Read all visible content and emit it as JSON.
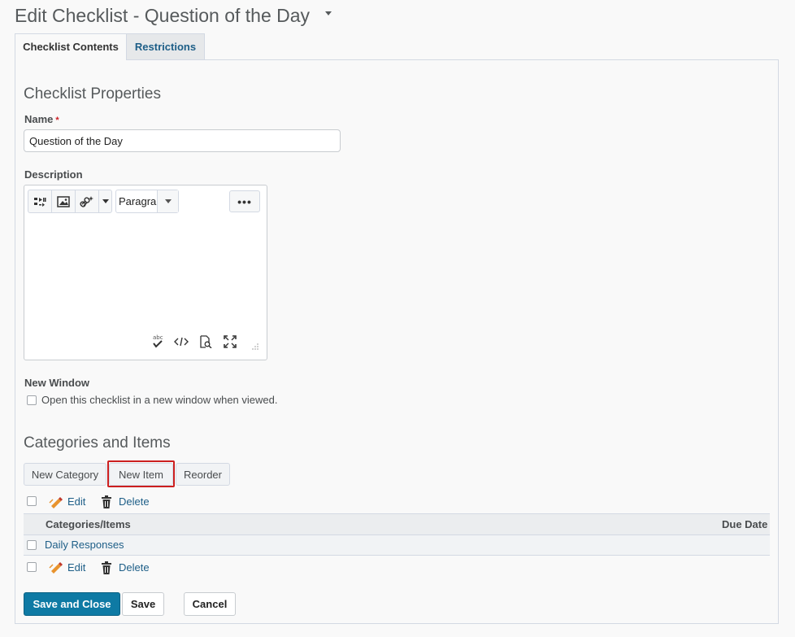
{
  "page": {
    "title": "Edit Checklist - Question of the Day"
  },
  "tabs": [
    {
      "label": "Checklist Contents"
    },
    {
      "label": "Restrictions"
    }
  ],
  "properties": {
    "heading": "Checklist Properties",
    "name_label": "Name",
    "required_marker": "*",
    "name_value": "Question of the Day",
    "description_label": "Description",
    "format_value": "Paragra",
    "more_label": "•••",
    "new_window_label": "New Window",
    "new_window_checkbox_label": "Open this checklist in a new window when viewed."
  },
  "categories": {
    "heading": "Categories and Items",
    "buttons": {
      "new_category": "New Category",
      "new_item": "New Item",
      "reorder": "Reorder"
    },
    "actions": {
      "edit": "Edit",
      "delete": "Delete"
    },
    "table": {
      "columns": [
        "Categories/Items",
        "Due Date"
      ],
      "rows": [
        {
          "name": "Daily Responses",
          "due_date": ""
        }
      ]
    }
  },
  "footer": {
    "save_and_close": "Save and Close",
    "save": "Save",
    "cancel": "Cancel"
  },
  "colors": {
    "primary": "#0e7aa4",
    "link": "#1d5e87",
    "highlight": "#cc1f1f",
    "icon_orange": "#e8932d"
  },
  "icons": {
    "title_menu": "chevron-down-icon",
    "insert_stuff": "insert-stuff-icon",
    "insert_image": "image-icon",
    "insert_link": "quicklink-icon",
    "spellcheck": "spellcheck-icon",
    "source_code": "code-icon",
    "preview": "preview-icon",
    "fullscreen": "fullscreen-icon",
    "edit": "pencil-icon",
    "delete": "trash-icon"
  }
}
